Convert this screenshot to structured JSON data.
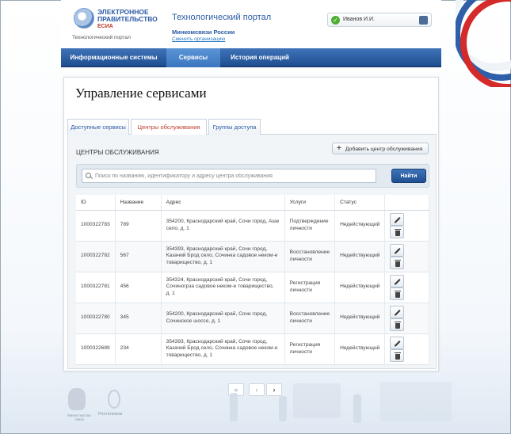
{
  "header": {
    "logo_line1": "ЭЛЕКТРОННОЕ",
    "logo_line2": "ПРАВИТЕЛЬСТВО",
    "logo_line3": "ЕСИА",
    "logo_sub": "Технологический портал",
    "portal_title": "Технологический портал",
    "ministry": "Минкомсвязи России",
    "change_org": "Сменить организацию",
    "user_name": "Иванов И.И."
  },
  "nav": {
    "items": [
      {
        "label": "Информационные системы",
        "active": false
      },
      {
        "label": "Сервисы",
        "active": true
      },
      {
        "label": "История операций",
        "active": false
      }
    ]
  },
  "page": {
    "title": "Управление сервисами",
    "tabs": [
      {
        "label": "Доступные сервисы",
        "active": false
      },
      {
        "label": "Центры обслуживания",
        "active": true
      },
      {
        "label": "Группы доступа",
        "active": false
      }
    ],
    "section_title": "ЦЕНТРЫ ОБСЛУЖИВАНИЯ",
    "add_button": "Добавить центр обслуживания",
    "search": {
      "placeholder": "Поиск по названию, идентификатору и адресу центра обслуживания",
      "value": "",
      "button": "Найти"
    }
  },
  "table": {
    "headers": [
      "ID",
      "Название",
      "Адрес",
      "Услуги",
      "Статус",
      ""
    ],
    "rows": [
      {
        "id": "1000322783",
        "name": "789",
        "address": "354200, Краснодарский край, Сочи город, Аше село, д. 1",
        "service": "Подтверждение личности",
        "status": "Недействующий"
      },
      {
        "id": "1000322782",
        "name": "567",
        "address": "354393, Краснодарский край, Сочи город, Казачий Брод село, Сочинка садовое неком-е товарищество, д. 1",
        "service": "Восстановление личности",
        "status": "Недействующий"
      },
      {
        "id": "1000322781",
        "name": "456",
        "address": "354324, Краснодарский край, Сочи город, Сочиногрза садовое неком-е товарищество, д. 1",
        "service": "Регистрация личности",
        "status": "Недействующий"
      },
      {
        "id": "1000322780",
        "name": "345",
        "address": "354200, Краснодарский край, Сочи город, Сочинское шоссе, д. 1",
        "service": "Восстановление личности",
        "status": "Недействующий"
      },
      {
        "id": "1000322689",
        "name": "234",
        "address": "354393, Краснодарский край, Сочи город, Казачий Брод село, Сочинка садовое неком-е товарищество, д. 1",
        "service": "Регистрация личности",
        "status": "Недействующий"
      }
    ]
  },
  "pager": {
    "first": "«",
    "prev": "‹",
    "next": "›"
  },
  "footer": {
    "org1": "Министерство связи",
    "org2": "Ростелеком"
  },
  "colors": {
    "accent": "#2a5aa4",
    "active_tab": "#c0392b",
    "nav": "#1f4f91"
  }
}
